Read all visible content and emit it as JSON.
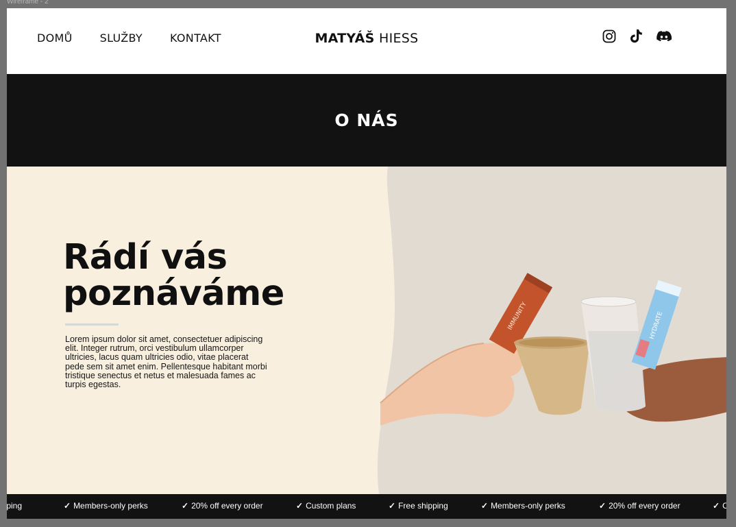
{
  "canvas": {
    "frame_label": "Wireframe - 2"
  },
  "nav": {
    "items": [
      {
        "label": "DOMŮ"
      },
      {
        "label": "SLUŽBY"
      },
      {
        "label": "KONTAKT"
      }
    ]
  },
  "brand": {
    "first": "MATYÁŠ",
    "last": "HIESS"
  },
  "socials": {
    "icons": [
      "instagram-icon",
      "tiktok-icon",
      "discord-icon"
    ]
  },
  "band": {
    "title": "O NÁS"
  },
  "hero": {
    "title_line1": "Rádí vás",
    "title_line2": "poznáváme",
    "body": "Lorem ipsum dolor sit amet, consectetuer adipiscing elit. Integer rutrum, orci vestibulum ullamcorper ultricies, lacus quam ultricies odio, vitae placerat pede sem sit amet enim. Pellentesque habitant morbi tristique senectus et netus et malesuada fames ac turpis egestas."
  },
  "marquee": {
    "check": "✓",
    "items": [
      {
        "text": "ipping"
      },
      {
        "text": "Members-only perks"
      },
      {
        "text": "20% off every order"
      },
      {
        "text": "Custom plans"
      },
      {
        "text": "Free shipping"
      },
      {
        "text": "Members-only perks"
      },
      {
        "text": "20% off every order"
      },
      {
        "text": "C"
      }
    ]
  },
  "colors": {
    "cream": "#f8efdf",
    "photo_bg": "#e2dbd1",
    "dark": "#121212",
    "stick_orange": "#c2532a",
    "stick_blue": "#8fc7ea"
  }
}
